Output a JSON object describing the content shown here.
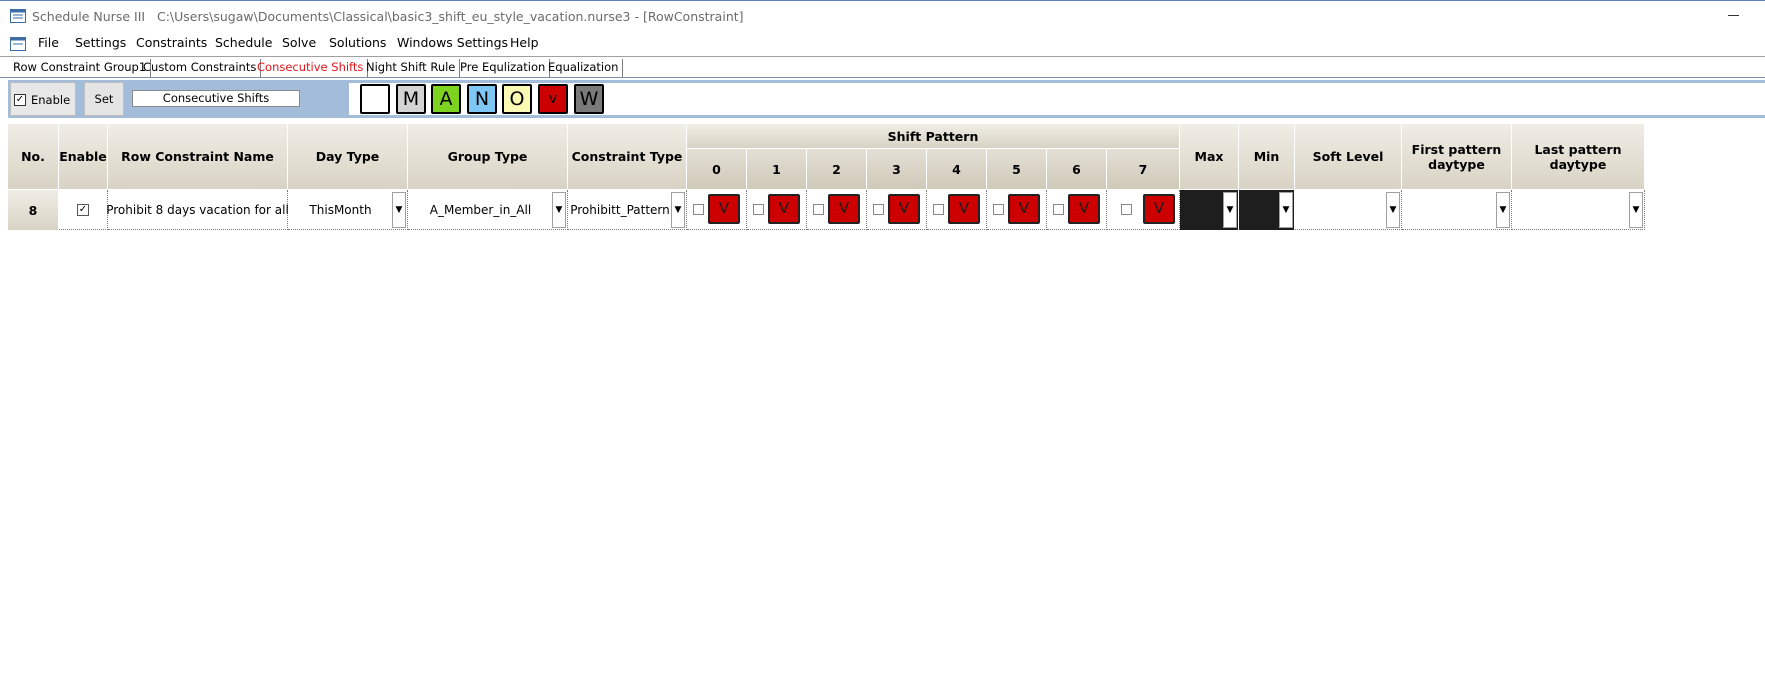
{
  "window": {
    "app_name": "Schedule Nurse III",
    "file_path": "C:\\Users\\sugaw\\Documents\\Classical\\basic3_shift_eu_style_vacation.nurse3 - [RowConstraint]"
  },
  "menu": [
    "File",
    "Settings",
    "Constraints",
    "Schedule",
    "Solve",
    "Solutions",
    "Windows Settings",
    "Help"
  ],
  "tabs": [
    {
      "label": "Row Constraint Group1",
      "active": false
    },
    {
      "label": "Custom Constraints",
      "active": false
    },
    {
      "label": "Consecutive Shifts",
      "active": true
    },
    {
      "label": "Night Shift Rule",
      "active": false
    },
    {
      "label": "Pre Equlization",
      "active": false
    },
    {
      "label": "Equalization",
      "active": false
    }
  ],
  "toolbar": {
    "enable_label": "Enable",
    "enable_checked": true,
    "set_label": "Set",
    "set_field_value": "Consecutive Shifts",
    "shift_buttons": [
      {
        "label": "",
        "color": "#ffffff"
      },
      {
        "label": "M",
        "color": "#d4d4d4"
      },
      {
        "label": "A",
        "color": "#7ed321"
      },
      {
        "label": "N",
        "color": "#7fc8f5"
      },
      {
        "label": "O",
        "color": "#fafab4"
      },
      {
        "label": "v",
        "color": "#cc0000"
      },
      {
        "label": "W",
        "color": "#7a7a7a"
      }
    ]
  },
  "grid": {
    "headers": {
      "no": "No.",
      "enable": "Enable",
      "name": "Row Constraint Name",
      "day_type": "Day Type",
      "group_type": "Group Type",
      "constraint_type": "Constraint Type",
      "shift_pattern": "Shift Pattern",
      "pattern_cols": [
        "0",
        "1",
        "2",
        "3",
        "4",
        "5",
        "6",
        "7"
      ],
      "max": "Max",
      "min": "Min",
      "soft_level": "Soft Level",
      "first_pattern_1": "First pattern",
      "first_pattern_2": "daytype",
      "last_pattern_1": "Last pattern",
      "last_pattern_2": "daytype"
    },
    "row": {
      "no": "8",
      "enable": true,
      "name": "Prohibit 8 days vacation for all",
      "day_type": "ThisMonth",
      "group_type": "A_Member_in_All",
      "constraint_type": "Prohibitt_Pattern",
      "pattern": [
        "V",
        "V",
        "V",
        "V",
        "V",
        "V",
        "V",
        "V"
      ],
      "max": "",
      "min": "",
      "soft_level": "",
      "first_pattern_daytype": "",
      "last_pattern_daytype": ""
    }
  }
}
